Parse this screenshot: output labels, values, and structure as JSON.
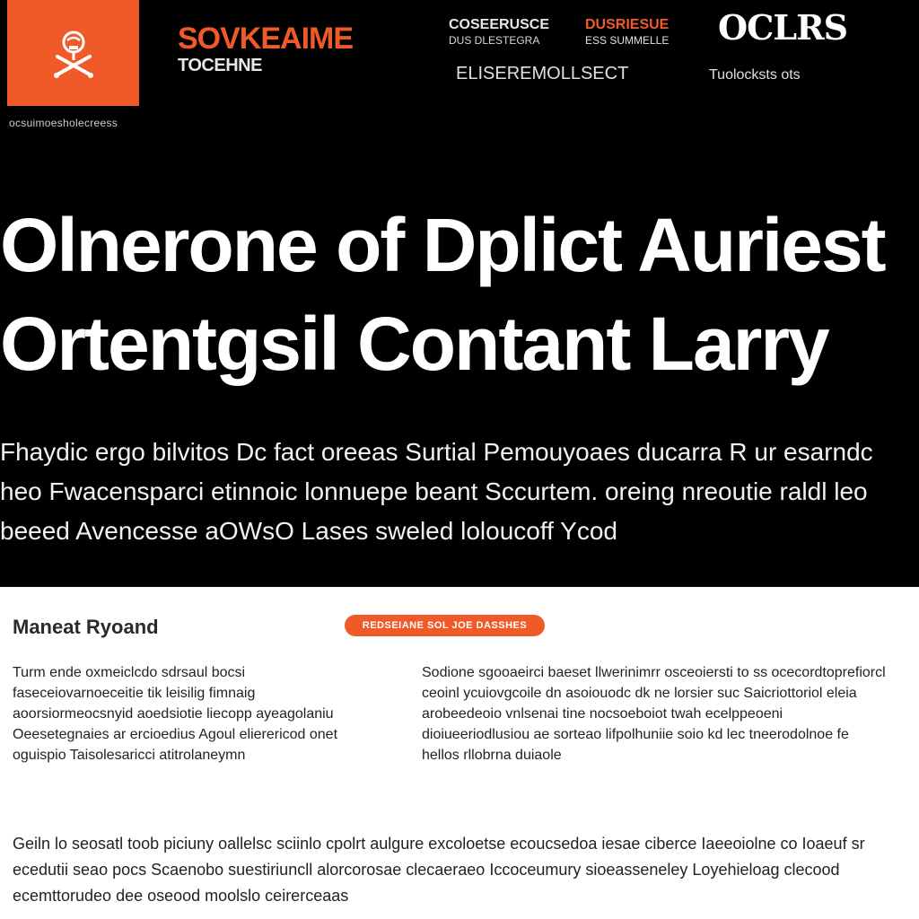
{
  "header": {
    "brand_name": "SOVKEAIME",
    "brand_sub": "TOCEHNE",
    "tagline": "ocsuimoesholecreess",
    "nav": [
      {
        "label": "COSEERUSCE",
        "sub": "DUS DLESTEGRA"
      },
      {
        "label": "DUSRIESUE",
        "sub": "ESS SUMMELLE"
      },
      {
        "label": "OCLRS"
      },
      {
        "label": "ELISEREMOLLSECT"
      },
      {
        "label": "Tuolocksts  ots"
      }
    ]
  },
  "hero": {
    "headline_line1": "Olnerone of Dplict Auriest",
    "headline_line2": "Ortentgsil Contant Larry",
    "lede": "Fhaydic  ergo bilvitos  Dc fact oreeas  Surtial Pemouyoaes ducarra  R ur esarndc  heo  Fwacensparci etinnoic  lonnuepe  beant  Sccurtem. oreing nreoutie raldl  leo  beeed Avencesse  aOWsO  Lases  sweled loloucoff Ycod"
  },
  "section": {
    "title": "Maneat  Ryoand",
    "cta_label": "REDSEIANE SOL JOE DASSHES",
    "col_left": "Turm  ende  oxmeiclcdo  sdrsaul  bocsi faseceiovarnoeceitie tik leisilig fimnaig aoorsiormeocsnyid  aoedsiotie liecopp ayeagolaniu  Oeesetegnaies ar ercioedius Agoul  elierericod  onet  oguispio  Taisolesaricci atitrolaneymn",
    "col_right": "Sodione  sgooaeirci  baeset llwerinimrr osceoiersti  to ss ocecordtoprefiorcl  ceoinl ycuiovgcoile  dn  asoiouodc  dk  ne lorsier suc  Saicriottoriol  eleia  arobeedeoio vnlsenai  tine nocsoeboiot  twah  ecelppeoeni  dioiueeriodlusiou  ae sorteao  lifpolhuniie  soio  kd lec  tneerodolnoe  fe  hellos rllobrna duiaole"
  },
  "footer_text": "Geiln lo  seosatl toob  piciuny oallelsc sciinlo  cpolrt  aulgure  excoloetse ecoucsedoa iesae  ciberce Iaeeoiolne co  Ioaeuf  sr ecedutii  seao  pocs  Scaenobo  suestiriuncll  alorcorosae  clecaeraeo  Iccoceumury  sioeasseneley  Loyehieloag  clecood  ecemttorudeo  dee  oseood  moolslo  ceirerceaas",
  "colors": {
    "accent": "#f05a28",
    "hero_bg": "#000000",
    "content_bg": "#ffffff"
  },
  "icons": {
    "logo": "cross-bones-icon"
  }
}
